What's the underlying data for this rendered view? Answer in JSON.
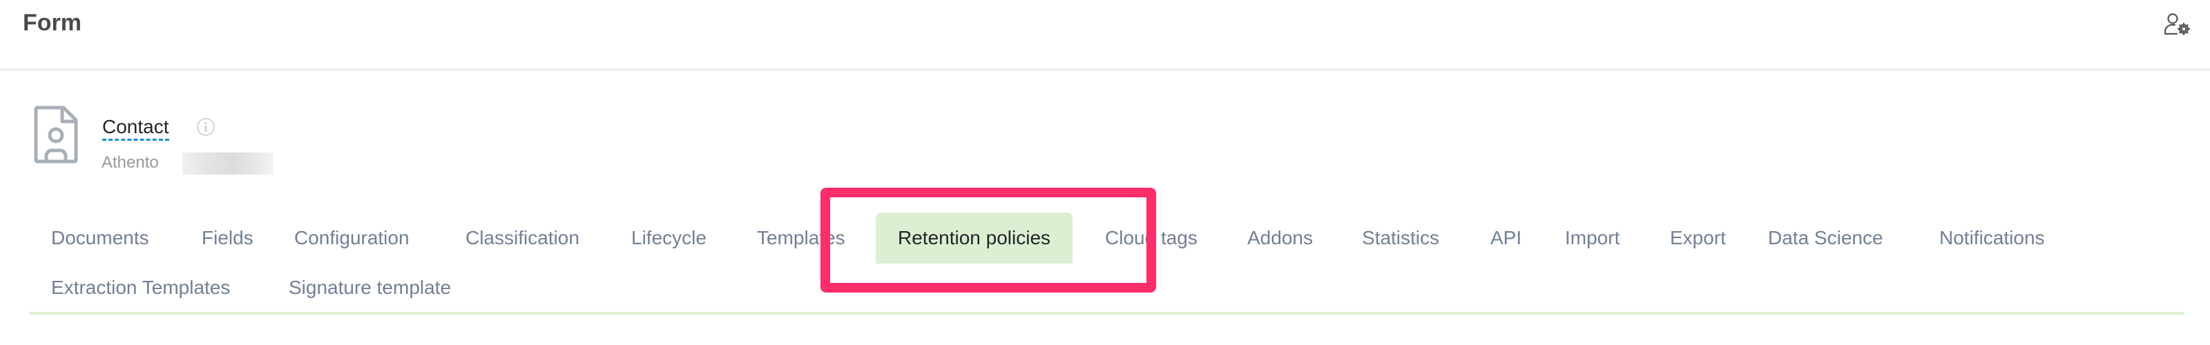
{
  "header": {
    "title": "Form",
    "user_settings_icon": "user-gear-icon"
  },
  "entity": {
    "icon": "file-user-icon",
    "name": "Contact",
    "info_icon": "info-icon",
    "owner": "Athento",
    "owner_detail": "[redacted]"
  },
  "tabs": [
    {
      "label": "Documents",
      "active": false
    },
    {
      "label": "Fields",
      "active": false
    },
    {
      "label": "Configuration",
      "active": false
    },
    {
      "label": "Classification",
      "active": false
    },
    {
      "label": "Lifecycle",
      "active": false
    },
    {
      "label": "Templates",
      "active": false
    },
    {
      "label": "Retention policies",
      "active": true
    },
    {
      "label": "Cloud tags",
      "active": false
    },
    {
      "label": "Addons",
      "active": false
    },
    {
      "label": "Statistics",
      "active": false
    },
    {
      "label": "API",
      "active": false
    },
    {
      "label": "Import",
      "active": false
    },
    {
      "label": "Export",
      "active": false
    },
    {
      "label": "Data Science",
      "active": false
    },
    {
      "label": "Notifications",
      "active": false
    },
    {
      "label": "Extraction Templates",
      "active": false
    },
    {
      "label": "Signature template",
      "active": false
    }
  ],
  "colors": {
    "active_tab_bg": "#dcefd2",
    "tab_text": "#718096",
    "highlight": "#ff2d6a",
    "link_underline": "#1a8fd0"
  }
}
